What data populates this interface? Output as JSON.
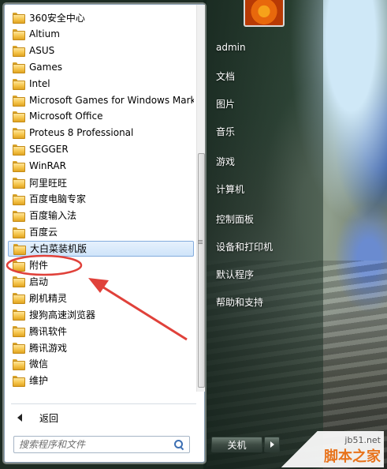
{
  "programs": [
    {
      "label": "360安全中心"
    },
    {
      "label": "Altium"
    },
    {
      "label": "ASUS"
    },
    {
      "label": "Games"
    },
    {
      "label": "Intel"
    },
    {
      "label": "Microsoft Games for Windows Marketplace"
    },
    {
      "label": "Microsoft Office"
    },
    {
      "label": "Proteus 8 Professional"
    },
    {
      "label": "SEGGER"
    },
    {
      "label": "WinRAR"
    },
    {
      "label": "阿里旺旺"
    },
    {
      "label": "百度电脑专家"
    },
    {
      "label": "百度输入法"
    },
    {
      "label": "百度云"
    },
    {
      "label": "大白菜装机版",
      "selected": true
    },
    {
      "label": "附件"
    },
    {
      "label": "启动"
    },
    {
      "label": "刷机精灵"
    },
    {
      "label": "搜狗高速浏览器"
    },
    {
      "label": "腾讯软件"
    },
    {
      "label": "腾讯游戏"
    },
    {
      "label": "微信"
    },
    {
      "label": "维护"
    }
  ],
  "back_label": "返回",
  "search": {
    "placeholder": "搜索程序和文件"
  },
  "right_menu": {
    "user": "admin",
    "documents": "文档",
    "pictures": "图片",
    "music": "音乐",
    "games": "游戏",
    "computer": "计算机",
    "control_panel": "控制面板",
    "devices_printers": "设备和打印机",
    "default_programs": "默认程序",
    "help_support": "帮助和支持"
  },
  "shutdown_label": "关机",
  "watermark": {
    "url": "jb51.net",
    "name": "脚本之家"
  },
  "colors": {
    "annotation": "#e0413a",
    "selection_border": "#84acdd"
  }
}
